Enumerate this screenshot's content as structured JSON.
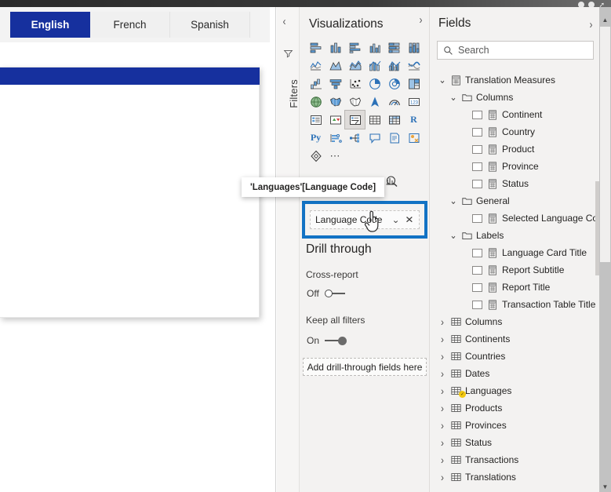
{
  "window": {
    "controls": [
      "minimize-dot",
      "maximize-dot",
      "restore-arrow"
    ]
  },
  "canvas": {
    "language_buttons": [
      {
        "label": "English",
        "active": true
      },
      {
        "label": "French",
        "active": false
      },
      {
        "label": "Spanish",
        "active": false
      }
    ],
    "accent_color": "#16309e",
    "card": {
      "header_color": "#16309e"
    }
  },
  "filters_rail": {
    "label": "Filters",
    "collapse_icon": "chevron-left-icon",
    "funnel_icon": "funnel-icon"
  },
  "visualizations": {
    "title": "Visualizations",
    "expand_icon": "chevron-right-icon",
    "icons": [
      "stacked-bar-chart-icon",
      "stacked-column-chart-icon",
      "clustered-bar-chart-icon",
      "clustered-column-chart-icon",
      "hundred-percent-stacked-bar-chart-icon",
      "hundred-percent-stacked-column-chart-icon",
      "line-chart-icon",
      "area-chart-icon",
      "stacked-area-chart-icon",
      "line-and-stacked-column-chart-icon",
      "line-and-clustered-column-chart-icon",
      "ribbon-chart-icon",
      "waterfall-chart-icon",
      "funnel-chart-icon",
      "scatter-chart-icon",
      "pie-chart-icon",
      "donut-chart-icon",
      "treemap-icon",
      "map-icon",
      "filled-map-icon",
      "shape-map-icon",
      "azure-map-icon",
      "gauge-icon",
      "card-icon",
      "multi-row-card-icon",
      "kpi-icon",
      "slicer-icon",
      "table-icon",
      "matrix-icon",
      "r-script-visual-icon",
      "python-visual-icon",
      "key-influencers-icon",
      "decomposition-tree-icon",
      "q-and-a-icon",
      "narrative-icon",
      "paginated-report-icon",
      "power-apps-icon",
      "more-visuals-icon"
    ],
    "selected_icon_index": 26,
    "pane_tabs": [
      "fields-tab-icon",
      "format-tab-icon",
      "analytics-tab-icon"
    ],
    "field_well": {
      "field_label": "Language Code",
      "dropdown_icon": "chevron-down-icon",
      "remove_icon": "close-icon",
      "highlight_color": "#1272c4"
    }
  },
  "tooltip": {
    "text": "'Languages'[Language Code]"
  },
  "cursor": {
    "type": "hand-pointer-cursor"
  },
  "drill_through": {
    "title": "Drill through",
    "cross_report": {
      "label": "Cross-report",
      "state": "Off",
      "on": false
    },
    "keep_all_filters": {
      "label": "Keep all filters",
      "state": "On",
      "on": true
    },
    "drop_zone": "Add drill-through fields here"
  },
  "fields": {
    "title": "Fields",
    "expand_icon": "chevron-right-icon",
    "search": {
      "placeholder": "Search",
      "value": "",
      "icon": "search-icon"
    },
    "tree": [
      {
        "label": "Translation Measures",
        "icon": "measure-table-icon",
        "indent": 1,
        "chevron": "down",
        "checkbox": false
      },
      {
        "label": "Columns",
        "icon": "folder-icon",
        "indent": 2,
        "chevron": "down",
        "checkbox": false
      },
      {
        "label": "Continent",
        "icon": "measure-icon",
        "indent": 3,
        "chevron": "none",
        "checkbox": true
      },
      {
        "label": "Country",
        "icon": "measure-icon",
        "indent": 3,
        "chevron": "none",
        "checkbox": true
      },
      {
        "label": "Product",
        "icon": "measure-icon",
        "indent": 3,
        "chevron": "none",
        "checkbox": true
      },
      {
        "label": "Province",
        "icon": "measure-icon",
        "indent": 3,
        "chevron": "none",
        "checkbox": true
      },
      {
        "label": "Status",
        "icon": "measure-icon",
        "indent": 3,
        "chevron": "none",
        "checkbox": true
      },
      {
        "label": "General",
        "icon": "folder-icon",
        "indent": 2,
        "chevron": "down",
        "checkbox": false
      },
      {
        "label": "Selected Language Code",
        "icon": "measure-icon",
        "indent": 3,
        "chevron": "none",
        "checkbox": true
      },
      {
        "label": "Labels",
        "icon": "folder-icon",
        "indent": 2,
        "chevron": "down",
        "checkbox": false
      },
      {
        "label": "Language Card Title",
        "icon": "measure-icon",
        "indent": 3,
        "chevron": "none",
        "checkbox": true
      },
      {
        "label": "Report Subtitle",
        "icon": "measure-icon",
        "indent": 3,
        "chevron": "none",
        "checkbox": true
      },
      {
        "label": "Report Title",
        "icon": "measure-icon",
        "indent": 3,
        "chevron": "none",
        "checkbox": true
      },
      {
        "label": "Transaction Table Title",
        "icon": "measure-icon",
        "indent": 3,
        "chevron": "none",
        "checkbox": true
      },
      {
        "label": "Columns",
        "icon": "table-icon",
        "indent": 1,
        "chevron": "right",
        "checkbox": false
      },
      {
        "label": "Continents",
        "icon": "table-icon",
        "indent": 1,
        "chevron": "right",
        "checkbox": false
      },
      {
        "label": "Countries",
        "icon": "table-icon",
        "indent": 1,
        "chevron": "right",
        "checkbox": false
      },
      {
        "label": "Dates",
        "icon": "table-icon",
        "indent": 1,
        "chevron": "right",
        "checkbox": false
      },
      {
        "label": "Languages",
        "icon": "table-icon",
        "indent": 1,
        "chevron": "right",
        "checkbox": false,
        "badge": true
      },
      {
        "label": "Products",
        "icon": "table-icon",
        "indent": 1,
        "chevron": "right",
        "checkbox": false
      },
      {
        "label": "Provinces",
        "icon": "table-icon",
        "indent": 1,
        "chevron": "right",
        "checkbox": false
      },
      {
        "label": "Status",
        "icon": "table-icon",
        "indent": 1,
        "chevron": "right",
        "checkbox": false
      },
      {
        "label": "Transactions",
        "icon": "table-icon",
        "indent": 1,
        "chevron": "right",
        "checkbox": false
      },
      {
        "label": "Translations",
        "icon": "table-icon",
        "indent": 1,
        "chevron": "right",
        "checkbox": false
      }
    ]
  },
  "scrollbar": {
    "up_icon": "scroll-up-arrow-icon",
    "down_icon": "scroll-down-arrow-icon"
  }
}
